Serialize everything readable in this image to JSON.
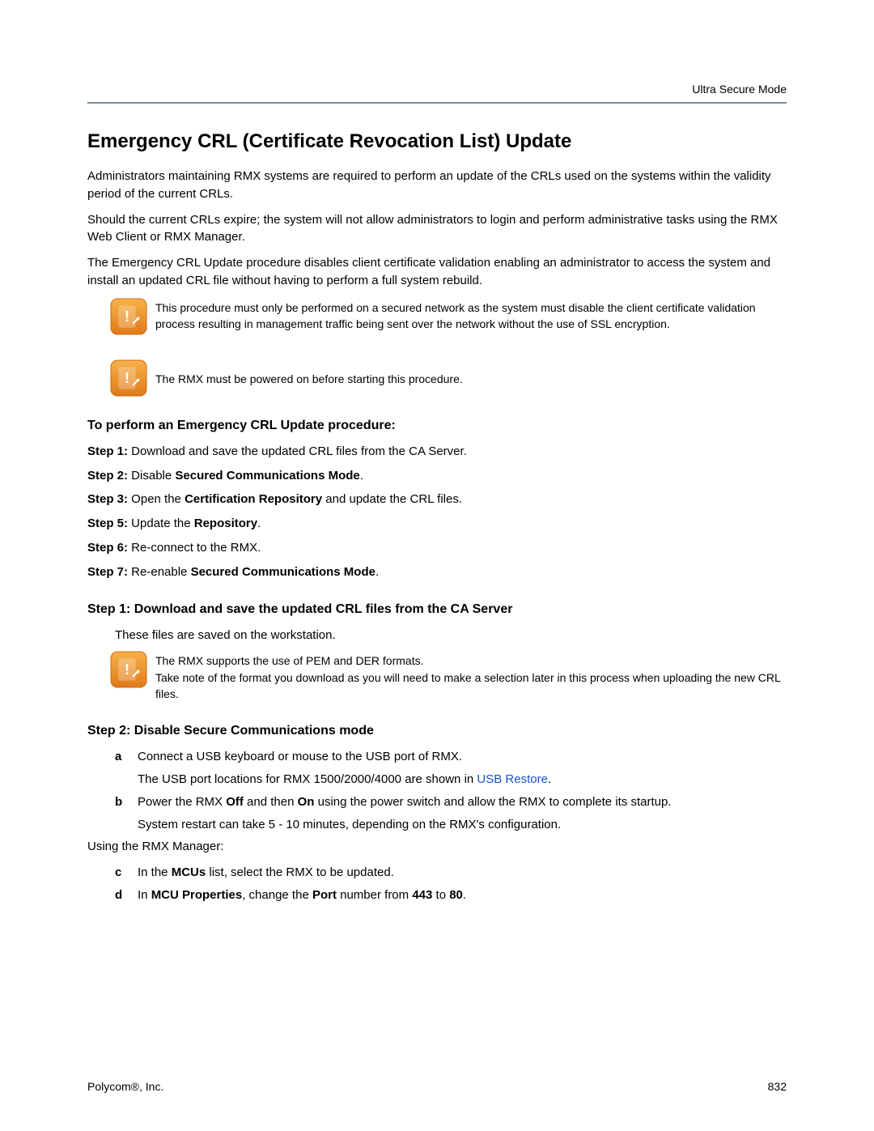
{
  "header": {
    "right": "Ultra Secure Mode"
  },
  "title": "Emergency CRL (Certificate Revocation List) Update",
  "intro": [
    "Administrators maintaining RMX systems are required to perform an update of the CRLs used on the systems within the validity period of the current CRLs.",
    "Should the current CRLs expire; the system will not allow administrators to login and perform administrative tasks using the RMX Web Client or RMX Manager.",
    "The Emergency CRL Update procedure disables client certificate validation enabling an administrator to access the system and install an updated CRL file without having to perform a full system rebuild."
  ],
  "notes": {
    "n1": "This procedure must only be performed on a secured network as the system must disable the client certificate validation process resulting in management traffic being sent over the network without the use of SSL encryption.",
    "n2": "The RMX must be powered on before starting this procedure.",
    "n3a": "The RMX supports the use of PEM and DER formats.",
    "n3b": "Take note of the format you download as you will need to make a selection later in this process when uploading the new CRL files."
  },
  "procedure_heading": "To perform an Emergency CRL Update procedure:",
  "steps": {
    "s1": {
      "label": "Step 1:",
      "text": " Download and save the updated CRL files from the CA Server."
    },
    "s2": {
      "label": "Step 2:",
      "pre": " Disable ",
      "bold": "Secured Communications Mode",
      "post": "."
    },
    "s3": {
      "label": "Step 3:",
      "pre": " Open the ",
      "bold": "Certification Repository",
      "post": " and update the CRL files."
    },
    "s5": {
      "label": "Step 5:",
      "pre": " Update the ",
      "bold": "Repository",
      "post": "."
    },
    "s6": {
      "label": "Step 6:",
      "text": " Re-connect to the RMX."
    },
    "s7": {
      "label": "Step 7:",
      "pre": " Re-enable ",
      "bold": "Secured Communications Mode",
      "post": "."
    }
  },
  "section_step1": {
    "heading": "Step 1: Download and save the updated CRL files from the CA Server",
    "line": "These files are saved on the workstation."
  },
  "section_step2": {
    "heading": "Step 2: Disable Secure Communications mode",
    "a": {
      "letter": "a",
      "text": "Connect a USB keyboard or mouse to the USB port of RMX."
    },
    "a_cont_pre": "The USB port locations for RMX 1500/2000/4000 are shown in ",
    "a_cont_link": "USB Restore",
    "a_cont_post": ".",
    "b": {
      "letter": "b",
      "pre": "Power the RMX ",
      "b1": "Off",
      "mid": " and then ",
      "b2": "On",
      "post": " using the power switch and allow the RMX to complete its startup."
    },
    "b_cont": "System restart can take 5 - 10 minutes, depending on the RMX's configuration.",
    "using": "Using the RMX Manager:",
    "c": {
      "letter": "c",
      "pre": "In the ",
      "b": "MCUs",
      "post": " list, select the RMX to be updated."
    },
    "d": {
      "letter": "d",
      "pre": "In ",
      "b1": "MCU Properties",
      "mid1": ", change the ",
      "b2": "Port",
      "mid2": " number from ",
      "b3": "443",
      "mid3": " to ",
      "b4": "80",
      "post": "."
    }
  },
  "footer": {
    "left": "Polycom®, Inc.",
    "right": "832"
  }
}
